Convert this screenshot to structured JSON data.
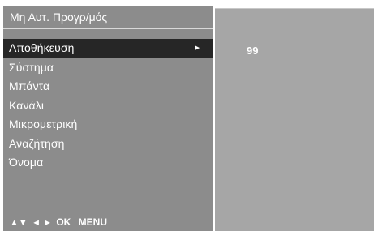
{
  "menu": {
    "title": "Μη Αυτ. Προγρ/μός",
    "items": [
      {
        "label": "Αποθήκευση",
        "selected": true,
        "submenu_arrow": "►"
      },
      {
        "label": "Σύστημα",
        "selected": false
      },
      {
        "label": "Μπάντα",
        "selected": false
      },
      {
        "label": "Κανάλι",
        "selected": false
      },
      {
        "label": "Μικρομετρική",
        "selected": false
      },
      {
        "label": "Αναζήτηση",
        "selected": false
      },
      {
        "label": "Όνομα",
        "selected": false
      }
    ]
  },
  "nav_hints": {
    "up_down": "▲▼",
    "left_right": "◄ ►",
    "ok": "OK",
    "menu": "MENU"
  },
  "value_panel": {
    "value": "99"
  },
  "colors": {
    "menu_bg": "#8c8c8c",
    "selected_bg": "#262626",
    "value_bg": "#a6a6a6",
    "text": "#ffffff"
  }
}
